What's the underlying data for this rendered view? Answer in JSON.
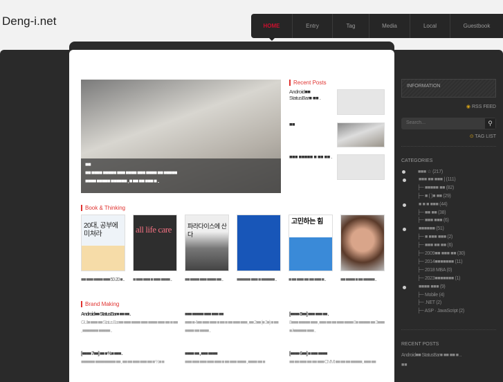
{
  "site": {
    "title": "Deng-i.net"
  },
  "nav": [
    {
      "label": "HOME",
      "active": true
    },
    {
      "label": "Entry"
    },
    {
      "label": "Tag"
    },
    {
      "label": "Media"
    },
    {
      "label": "Local"
    },
    {
      "label": "Guestbook"
    }
  ],
  "hero": {
    "line1": "■■",
    "line2": "■■ ■■■■ ■■■■■ ■■■ ■■■■ ■■■ ■■■■ ■■ ■■■■■",
    "line3": "■■■■ ■■■■■ ■■■■■■ , ■ ■■ ■■ ■■■ ■ .."
  },
  "recent_posts": {
    "title": "Recent Posts",
    "items": [
      {
        "text": "Android■■ StatusBar■ ■■ ."
      },
      {
        "text": "■■"
      },
      {
        "text": "■■■ ■■■■■ ■ ■■ ■■ ."
      }
    ]
  },
  "books": {
    "title": "Book & Thinking",
    "items": [
      {
        "cover": "20대, 공부에 미쳐라",
        "caption": "■■ ■■■ ■■■■ ■■■ 50·20 ■ .."
      },
      {
        "cover": "all life care",
        "caption": "■ ■■■ ■■■ ■ ■■■ ■■■■ .."
      },
      {
        "cover": "파라다이스에 산다",
        "caption": "■■ ■■■■ ■■■ ■■■■ ■■ .."
      },
      {
        "cover": "",
        "caption": "■■■■■■ ■■■ ■ ■■■■■■ .."
      },
      {
        "cover": "고민하는 힘",
        "caption": "■ ■■ ■■■ ■■ ■■ ■■■ ■ .."
      },
      {
        "cover": "",
        "caption": "■■ ■■■■ ■ ■■ ■■■■■ .."
      }
    ]
  },
  "brand": {
    "title": "Brand Making",
    "posts": [
      {
        "title": "Android■■ StatusBar■ ■■ ■■ .",
        "body": "GUI■ ■■■ ■■ Status Bar■■ ■■■ ■■■■ ■■■ ■■■■ ■■■ ■■ ■ ■■ , ■■■■■■■ ■■■■■ .."
      },
      {
        "title": "■■■ ■■■■■ ■■■ ■■■ ■■",
        "body": "■■■ ■ 4■■ ■■■ ■■■ ■ ■■ ■ ■■ ■■■ ■■■ , ■■ 2■■ (■ 3■) ■ ■■ ■■■■ ■■ ■■■■ .."
      },
      {
        "title": "[■■■■ 8■■] ■■■ ■■■ ■■ .",
        "body": "8■■■ ■■■■■ ■■■ , ■■■ ■■ ■■ ■■■ ■■■■ 8■ ■■■■■ ■■ 3■■■ ■ /■■■■■■ ■■■ .."
      },
      {
        "title": "[■■■■ 7■■] ■■ ■ %■ ■■■ .",
        "body": "■■■■■■ ■■■■■■■■■ ■■ , ■■ ■■ ■■■ ■■■ ■■ ■ %■ ■"
      },
      {
        "title": "■■■■ ■■ , ■■■ ■■■■",
        "body": "■■■ ■■■ ■■■ ■■■ ■■■ ■ ■■ ■■■ ■■■■ , ■■■■ ■■ ■"
      },
      {
        "title": "[■■■■ 6■■] ■ ■■■ ■■■■",
        "body": "■■ ■■ ■■■ ■■ ■■ ■■■ CMMI ■■ ■■ ■■ ■■■■■ , ■■■ ■■"
      }
    ]
  },
  "sidebar": {
    "info": "INFORMATION",
    "rss": "RSS FEED",
    "search_placeholder": "Search...",
    "tag_list": "TAG LIST",
    "categories_title": "CATEGORIES",
    "categories": [
      {
        "label": "■■■ ☆",
        "count": "(217)",
        "level": 0
      },
      {
        "label": "■■■ ■■ ■■■ |",
        "count": "(111)",
        "level": 1
      },
      {
        "label": "■■■■■ ■■",
        "count": "(82)",
        "level": 2
      },
      {
        "label": "■ ( )■ ■■",
        "count": "(29)",
        "level": 2
      },
      {
        "label": "■ ■ ■ ■■■",
        "count": "(44)",
        "level": 1
      },
      {
        "label": "■■ ■■",
        "count": "(38)",
        "level": 2
      },
      {
        "label": "■■■ ■■■",
        "count": "(6)",
        "level": 2
      },
      {
        "label": "■■■■■■",
        "count": "(51)",
        "level": 1
      },
      {
        "label": "■ ■■■ ■■■",
        "count": "(2)",
        "level": 2
      },
      {
        "label": "■■■ ■■ ■■",
        "count": "(6)",
        "level": 2
      },
      {
        "label": "2009■■ ■■■ ■■",
        "count": "(30)",
        "level": 2
      },
      {
        "label": "2014■■■■■■■",
        "count": "(11)",
        "level": 2
      },
      {
        "label": "2018 MBA",
        "count": "(0)",
        "level": 2
      },
      {
        "label": "2023■■■■■■■",
        "count": "(1)",
        "level": 2
      },
      {
        "label": "■■■■ ■■■",
        "count": "(9)",
        "level": 1
      },
      {
        "label": "Mobile",
        "count": "(4)",
        "level": 2
      },
      {
        "label": ".NET",
        "count": "(2)",
        "level": 2
      },
      {
        "label": "ASP · JavaScript",
        "count": "(2)",
        "level": 2
      }
    ],
    "recent_title": "RECENT POSTS",
    "recent": [
      "Android■■ StatusBar■ ■■ ■■ ■ ..",
      "■■"
    ]
  }
}
